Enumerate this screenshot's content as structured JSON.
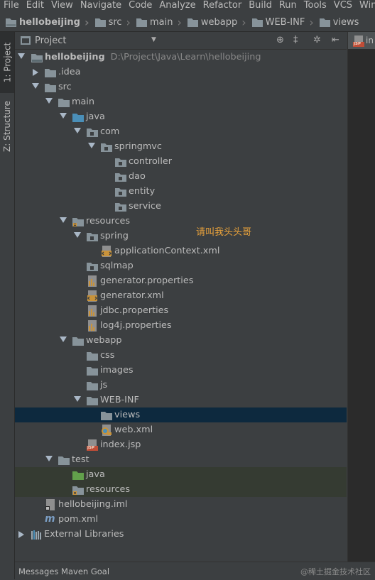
{
  "menu": [
    "File",
    "Edit",
    "View",
    "Navigate",
    "Code",
    "Analyze",
    "Refactor",
    "Build",
    "Run",
    "Tools",
    "VCS",
    "Windo"
  ],
  "breadcrumbs": [
    "hellobeijing",
    "src",
    "main",
    "webapp",
    "WEB-INF",
    "views"
  ],
  "left_tabs": [
    "1: Project",
    "Z: Structure"
  ],
  "panel": {
    "title": "Project"
  },
  "tree": {
    "root_name": "hellobeijing",
    "root_path": "D:\\Project\\Java\\Learn\\hellobeijing",
    "items": [
      "hellobeijing",
      ".idea",
      "src",
      "main",
      "java",
      "com",
      "springmvc",
      "controller",
      "dao",
      "entity",
      "service",
      "resources",
      "spring",
      "applicationContext.xml",
      "sqlmap",
      "generator.properties",
      "generator.xml",
      "jdbc.properties",
      "log4j.properties",
      "webapp",
      "css",
      "images",
      "js",
      "WEB-INF",
      "views",
      "web.xml",
      "index.jsp",
      "test",
      "java",
      "resources",
      "hellobeijing.iml",
      "pom.xml",
      "External Libraries"
    ]
  },
  "annotation": "请叫我头头哥",
  "editor_tab": "in",
  "editor_tab_badge": "JSP",
  "file_badge_jsp": "JSP",
  "status": {
    "message": "Messages Maven Goal"
  },
  "watermark": "@稀土掘金技术社区",
  "colors": {
    "background": "#3c3f41",
    "selection": "#0d293e",
    "test_highlight": "#353b32",
    "annotation": "#e8a23c",
    "folder": "#87939a",
    "source_folder": "#4a8fb8",
    "test_folder": "#62a04b"
  }
}
